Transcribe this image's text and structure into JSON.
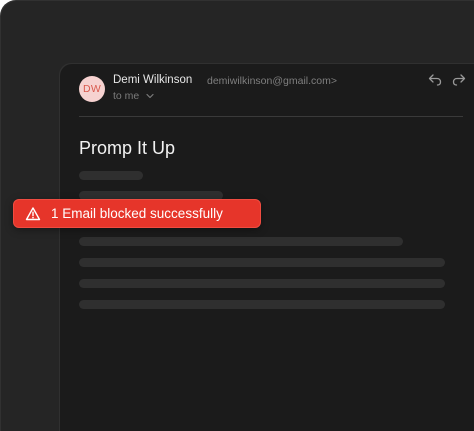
{
  "email": {
    "avatar_initials": "DW",
    "sender_name": "Demi Wilkinson",
    "sender_email": "demiwilkinson@gmail.com>",
    "recipient": "to me",
    "subject": "Promp It Up",
    "actions": {
      "reply_icon": "reply-icon",
      "forward_icon": "forward-icon"
    }
  },
  "toast": {
    "message": "1 Email blocked successfully",
    "icon": "warning-icon",
    "color": "#e6352a"
  },
  "colors": {
    "background": "#252525",
    "panel": "#1b1b1b",
    "avatar_bg": "#f6d2d0",
    "avatar_text": "#d95a4e"
  }
}
